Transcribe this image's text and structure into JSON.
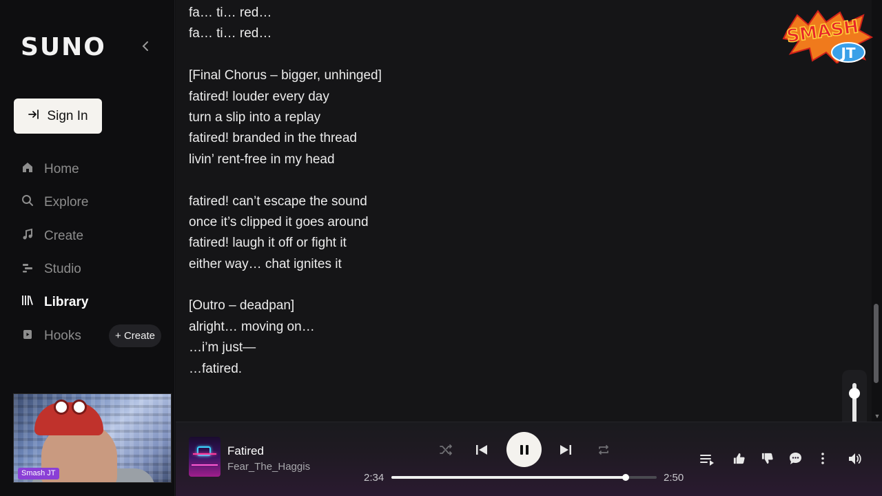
{
  "sidebar": {
    "logo": "SUNO",
    "collapse_icon": "chevron-left-icon",
    "sign_in_label": "Sign In",
    "items": [
      {
        "label": "Home",
        "icon": "home-icon",
        "active": false
      },
      {
        "label": "Explore",
        "icon": "search-icon",
        "active": false
      },
      {
        "label": "Create",
        "icon": "music-note-icon",
        "active": false
      },
      {
        "label": "Studio",
        "icon": "studio-icon",
        "active": false
      },
      {
        "label": "Library",
        "icon": "library-icon",
        "active": true
      },
      {
        "label": "Hooks",
        "icon": "hooks-icon",
        "active": false
      }
    ],
    "hooks_create_label": "+ Create"
  },
  "webcam": {
    "tag": "Smash JT"
  },
  "overlay_logo": {
    "text_top": "SMASH",
    "text_bottom": "JT"
  },
  "lyrics": [
    "fa… ti… red…",
    "fa… ti… red…",
    "",
    "[Final Chorus – bigger, unhinged]",
    "fatired! louder every day",
    "turn a slip into a replay",
    "fatired! branded in the thread",
    "livin’ rent-free in my head",
    "",
    "fatired! can’t escape the sound",
    "once it’s clipped it goes around",
    "fatired! laugh it off or fight it",
    "either way… chat ignites it",
    "",
    "[Outro – deadpan]",
    "alright… moving on…",
    "…i’m just—",
    "…fatired."
  ],
  "player": {
    "title": "Fatired",
    "artist": "Fear_The_Haggis",
    "current_time": "2:34",
    "total_time": "2:50",
    "progress": 0.884,
    "is_playing": true,
    "volume": 0.9
  },
  "colors": {
    "accent_tag": "#8a3fd6",
    "sidebar_bg": "#0e0e10",
    "main_bg": "#151517",
    "sign_in_bg": "#f5f3ef"
  }
}
